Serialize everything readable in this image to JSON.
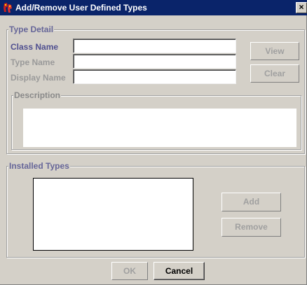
{
  "window": {
    "title": "Add/Remove User Defined Types",
    "close_glyph": "×"
  },
  "type_detail": {
    "group_title": "Type Detail",
    "class_name_label": "Class Name",
    "class_name_value": "",
    "type_name_label": "Type Name",
    "type_name_value": "",
    "display_name_label": "Display Name",
    "display_name_value": "",
    "view_button": "View",
    "clear_button": "Clear",
    "description": {
      "group_title": "Description",
      "value": ""
    }
  },
  "installed_types": {
    "group_title": "Installed Types",
    "items": [],
    "add_button": "Add",
    "remove_button": "Remove"
  },
  "footer": {
    "ok_button": "OK",
    "cancel_button": "Cancel"
  },
  "colors": {
    "title_bar": "#0a246a",
    "dialog_background": "#d4d0c8",
    "group_title_text": "#666699",
    "active_label_text": "#505090",
    "disabled_text": "#a0a0a0"
  }
}
